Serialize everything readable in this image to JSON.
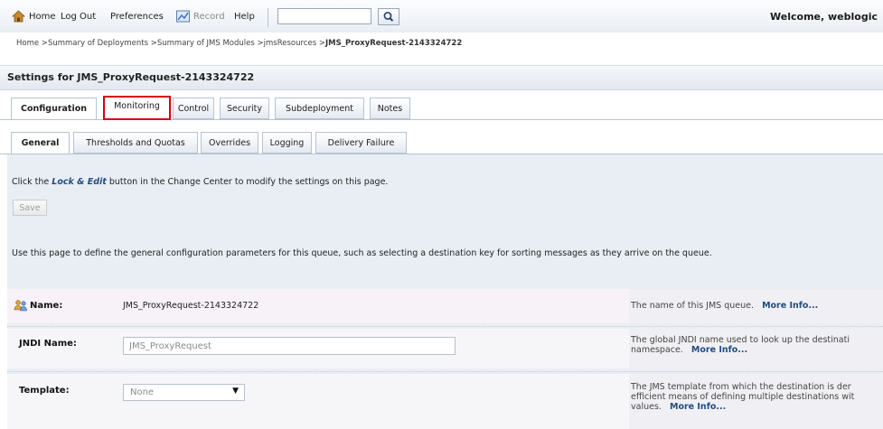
{
  "toolbar": {
    "home": "Home",
    "logout": "Log Out",
    "preferences": "Preferences",
    "record": "Record",
    "help": "Help",
    "search_value": "",
    "welcome": "Welcome, weblogic"
  },
  "breadcrumb": {
    "items": [
      "Home",
      "Summary of Deployments",
      "Summary of JMS Modules",
      "jmsResources"
    ],
    "current": "JMS_ProxyRequest-2143324722"
  },
  "page": {
    "title": "Settings for JMS_ProxyRequest-2143324722"
  },
  "tabs_primary": [
    "Configuration",
    "Monitoring",
    "Control",
    "Security",
    "Subdeployment",
    "Notes"
  ],
  "tabs_secondary": [
    "General",
    "Thresholds and Quotas",
    "Overrides",
    "Logging",
    "Delivery Failure"
  ],
  "lock_message": {
    "pre": "Click the ",
    "emphasis": "Lock & Edit",
    "post": " button in the Change Center to modify the settings on this page."
  },
  "save_label": "Save",
  "intro": "Use this page to define the general configuration parameters for this queue, such as selecting a destination key for sorting messages as they arrive on the queue.",
  "fields": {
    "name": {
      "label": "Name:",
      "value": "JMS_ProxyRequest-2143324722",
      "help": "The name of this JMS queue.",
      "more": "More Info..."
    },
    "jndi": {
      "label": "JNDI Name:",
      "value": "JMS_ProxyRequest",
      "help_line1": "The global JNDI name used to look up the destinati",
      "help_line2": "namespace.",
      "more": "More Info..."
    },
    "template": {
      "label": "Template:",
      "value": "None",
      "help_line1": "The JMS template from which the destination is der",
      "help_line2": "efficient means of defining multiple destinations wit",
      "help_line3": "values.",
      "more": "More Info..."
    }
  },
  "colors": {
    "highlight_box": "#d8000c",
    "link": "#214d82",
    "content_bg": "#e9eef4"
  }
}
